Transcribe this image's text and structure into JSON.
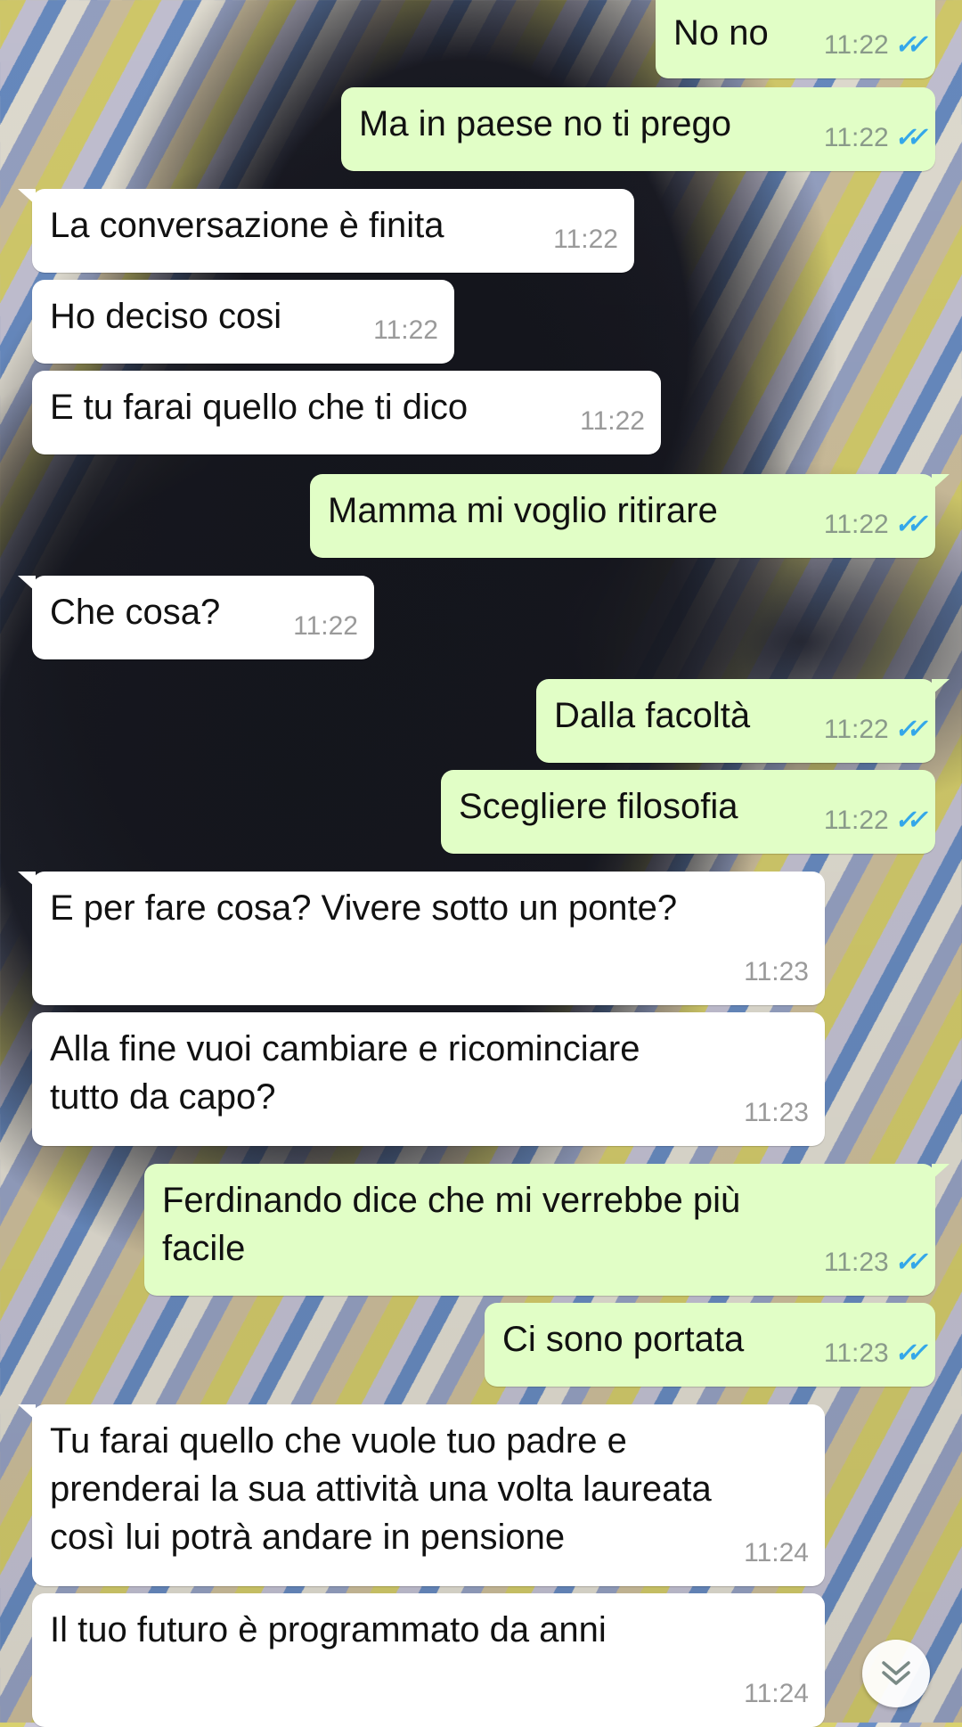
{
  "messages": [
    {
      "dir": "out",
      "text": "No no",
      "time": "11:22",
      "status": "read"
    },
    {
      "dir": "out",
      "text": "Ma in paese no ti prego",
      "time": "11:22",
      "status": "read"
    },
    {
      "dir": "in",
      "text": "La conversazione è finita",
      "time": "11:22"
    },
    {
      "dir": "in",
      "text": "Ho deciso cosi",
      "time": "11:22"
    },
    {
      "dir": "in",
      "text": "E tu farai quello che ti dico",
      "time": "11:22"
    },
    {
      "dir": "out",
      "text": "Mamma mi voglio ritirare",
      "time": "11:22",
      "status": "read"
    },
    {
      "dir": "in",
      "text": "Che cosa?",
      "time": "11:22"
    },
    {
      "dir": "out",
      "text": "Dalla facoltà",
      "time": "11:22",
      "status": "read"
    },
    {
      "dir": "out",
      "text": "Scegliere filosofia",
      "time": "11:22",
      "status": "read"
    },
    {
      "dir": "in",
      "text": "E per fare cosa? Vivere sotto un ponte?",
      "time": "11:23"
    },
    {
      "dir": "in",
      "text": "Alla fine vuoi cambiare e ricominciare\ntutto da capo?",
      "time": "11:23"
    },
    {
      "dir": "out",
      "text": "Ferdinando dice che mi verrebbe più\nfacile",
      "time": "11:23",
      "status": "read"
    },
    {
      "dir": "out",
      "text": "Ci sono portata",
      "time": "11:23",
      "status": "read"
    },
    {
      "dir": "in",
      "text": "Tu farai quello che vuole tuo padre e\nprenderai la sua attività una volta laureata\ncosì lui potrà andare in pensione",
      "time": "11:24"
    },
    {
      "dir": "in",
      "text": "Il tuo futuro è programmato da anni",
      "time": "11:24"
    }
  ],
  "icons": {
    "read_receipt": "double-check-icon",
    "scroll_down": "chevron-double-down-icon"
  },
  "colors": {
    "outgoing": "#e1fec6",
    "incoming": "#ffffff",
    "tick": "#34a7e9"
  }
}
